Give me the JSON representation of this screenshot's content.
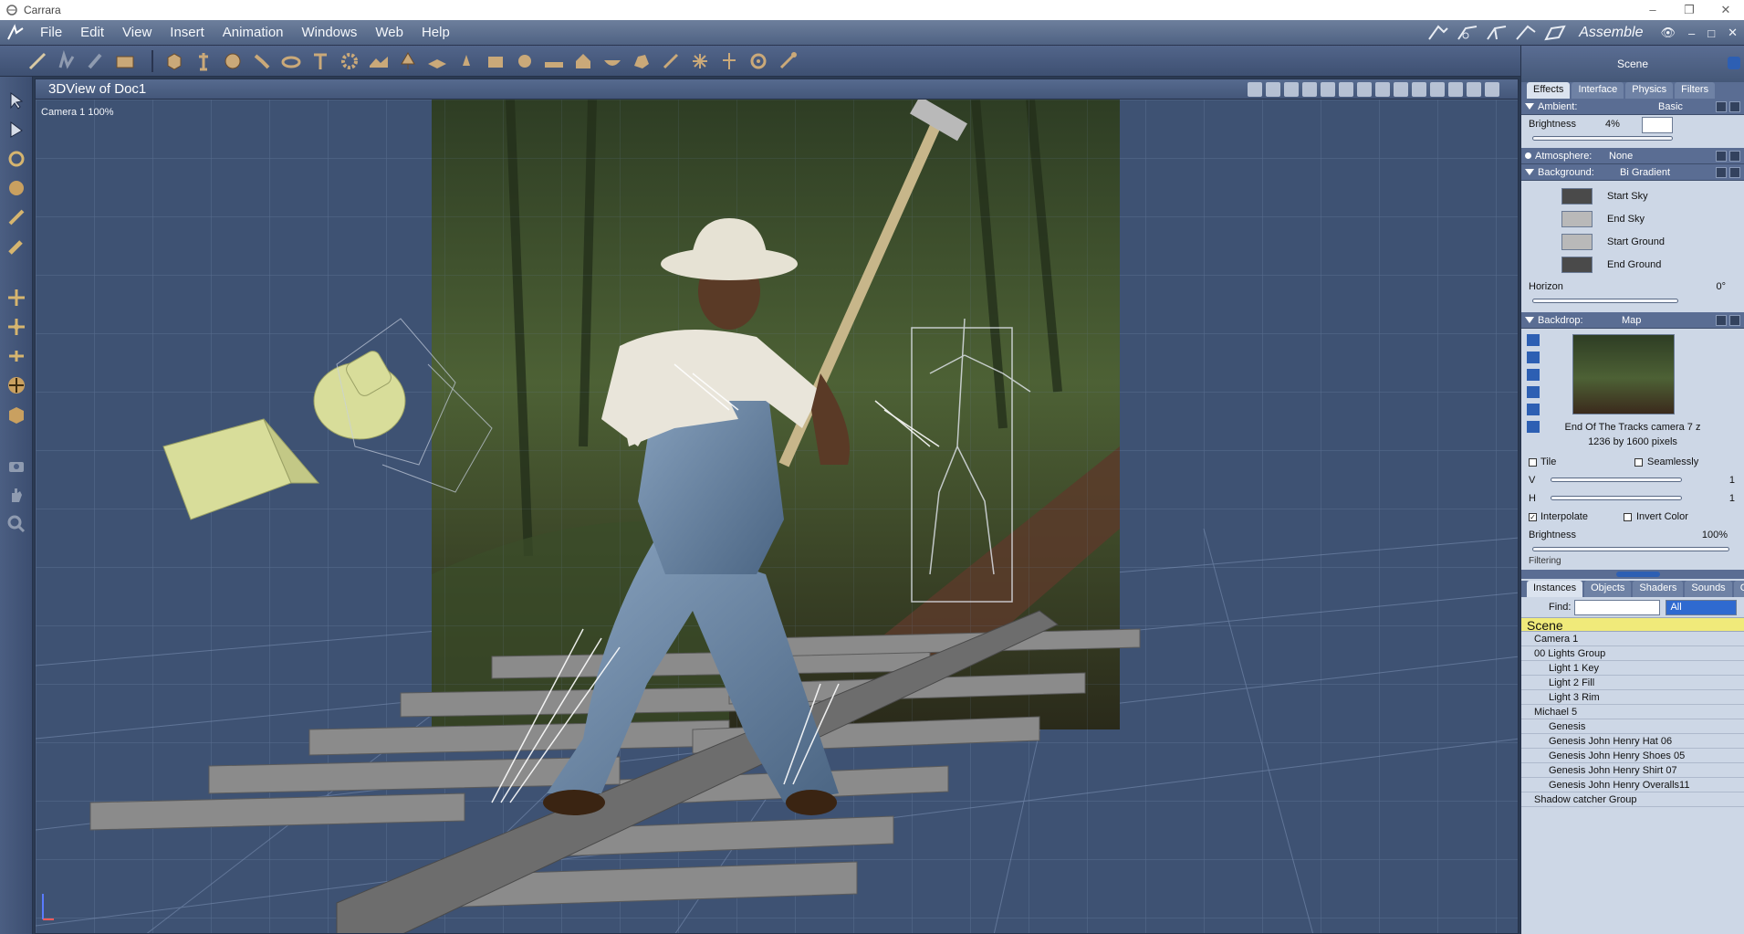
{
  "window": {
    "title": "Carrara"
  },
  "menu": {
    "items": [
      "File",
      "Edit",
      "View",
      "Insert",
      "Animation",
      "Windows",
      "Web",
      "Help"
    ],
    "room": "Assemble"
  },
  "viewport": {
    "title": "3DView of Doc1",
    "camera_label": "Camera 1 100%"
  },
  "panel": {
    "title": "Scene",
    "tabs": [
      "Effects",
      "Interface",
      "Physics",
      "Filters"
    ],
    "ambient": {
      "label": "Ambient:",
      "value": "Basic",
      "brightness_label": "Brightness",
      "brightness_value": "4%"
    },
    "atmosphere": {
      "label": "Atmosphere:",
      "value": "None"
    },
    "background": {
      "label": "Background:",
      "value": "Bi Gradient",
      "colors": [
        {
          "label": "Start Sky",
          "color": "#4a4a4a"
        },
        {
          "label": "End Sky",
          "color": "#b9b9b9"
        },
        {
          "label": "Start Ground",
          "color": "#b9b9b9"
        },
        {
          "label": "End Ground",
          "color": "#4a4a4a"
        }
      ],
      "horizon_label": "Horizon",
      "horizon_value": "0°"
    },
    "backdrop": {
      "label": "Backdrop:",
      "value": "Map",
      "map_name": "End Of The Tracks camera 7 z",
      "map_size": "1236 by 1600 pixels",
      "tile_label": "Tile",
      "seamlessly_label": "Seamlessly",
      "v_label": "V",
      "v_value": "1",
      "h_label": "H",
      "h_value": "1",
      "interpolate_label": "Interpolate",
      "invert_label": "Invert Color",
      "brightness_label": "Brightness",
      "brightness_value": "100%",
      "filtering_label": "Filtering"
    }
  },
  "instances": {
    "tabs": [
      "Instances",
      "Objects",
      "Shaders",
      "Sounds",
      "Clips"
    ],
    "find_label": "Find:",
    "find_value": "",
    "filter_value": "All",
    "tree_root": "Scene",
    "tree": [
      {
        "label": "Camera 1",
        "depth": 0
      },
      {
        "label": "00 Lights Group",
        "depth": 0
      },
      {
        "label": "Light 1 Key",
        "depth": 1
      },
      {
        "label": "Light 2 Fill",
        "depth": 1
      },
      {
        "label": "Light 3 Rim",
        "depth": 1
      },
      {
        "label": "Michael 5",
        "depth": 0
      },
      {
        "label": "Genesis",
        "depth": 1
      },
      {
        "label": "Genesis John Henry Hat 06",
        "depth": 1
      },
      {
        "label": "Genesis John Henry Shoes 05",
        "depth": 1
      },
      {
        "label": "Genesis John Henry Shirt 07",
        "depth": 1
      },
      {
        "label": "Genesis John Henry Overalls11",
        "depth": 1
      },
      {
        "label": "Shadow catcher Group",
        "depth": 0
      }
    ]
  },
  "colors": {
    "accent": "#2f6ad0",
    "scene_highlight": "#f0ea7a",
    "viewport_bg": "#3e5273",
    "panel_bg": "#cdd7e6"
  }
}
